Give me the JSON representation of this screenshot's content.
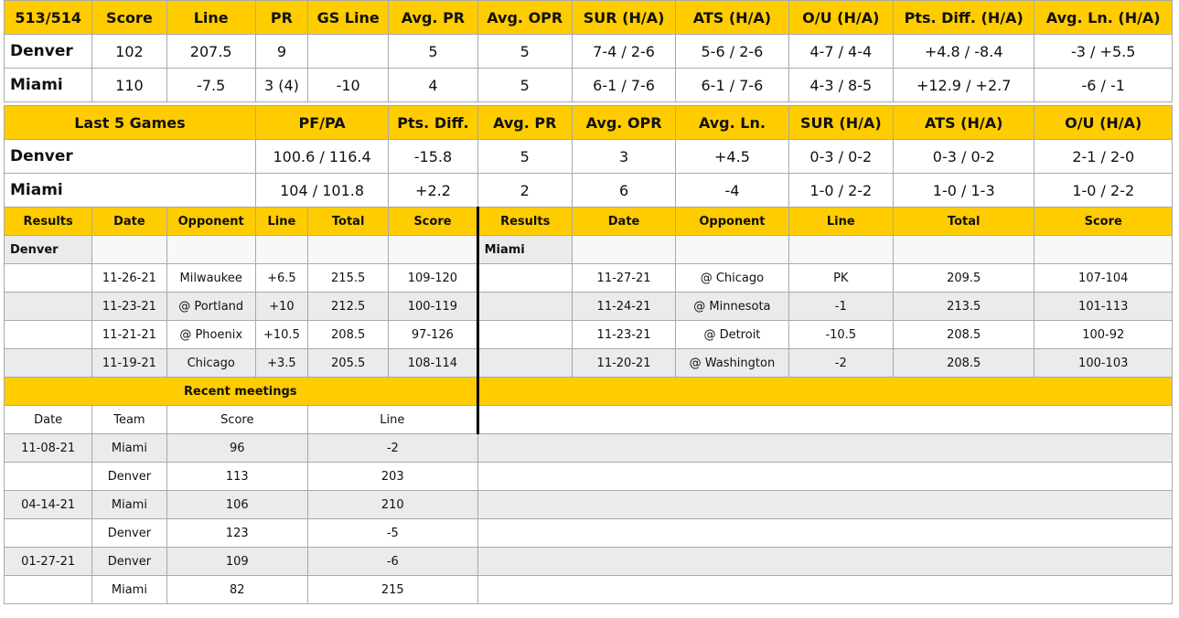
{
  "summary": {
    "headers": [
      "513/514",
      "Score",
      "Line",
      "PR",
      "GS Line",
      "Avg. PR",
      "Avg. OPR",
      "SUR (H/A)",
      "ATS (H/A)",
      "O/U (H/A)",
      "Pts. Diff. (H/A)",
      "Avg. Ln. (H/A)"
    ],
    "rows": [
      {
        "team": "Denver",
        "score": "102",
        "line": "207.5",
        "pr": "9",
        "gs_line": "",
        "avg_pr": "5",
        "avg_opr": "5",
        "sur": "7-4 / 2-6",
        "ats": "5-6 / 2-6",
        "ou": "4-7 / 4-4",
        "pts_diff": "+4.8 / -8.4",
        "avg_ln": "-3 / +5.5"
      },
      {
        "team": "Miami",
        "score": "110",
        "line": "-7.5",
        "pr": "3 (4)",
        "gs_line": "-10",
        "avg_pr": "4",
        "avg_opr": "5",
        "sur": "6-1 / 7-6",
        "ats": "6-1 / 7-6",
        "ou": "4-3 / 8-5",
        "pts_diff": "+12.9 / +2.7",
        "avg_ln": "-6 / -1"
      }
    ]
  },
  "last5": {
    "headers": [
      "Last 5 Games",
      "PF/PA",
      "Pts. Diff.",
      "Avg. PR",
      "Avg. OPR",
      "Avg. Ln.",
      "SUR (H/A)",
      "ATS (H/A)",
      "O/U (H/A)"
    ],
    "rows": [
      {
        "team": "Denver",
        "pfpa": "100.6 / 116.4",
        "pts_diff": "-15.8",
        "avg_pr": "5",
        "avg_opr": "3",
        "avg_ln": "+4.5",
        "sur": "0-3 / 0-2",
        "ats": "0-3 / 0-2",
        "ou": "2-1 / 2-0"
      },
      {
        "team": "Miami",
        "pfpa": "104 / 101.8",
        "pts_diff": "+2.2",
        "avg_pr": "2",
        "avg_opr": "6",
        "avg_ln": "-4",
        "sur": "1-0 / 2-2",
        "ats": "1-0 / 1-3",
        "ou": "1-0 / 2-2"
      }
    ]
  },
  "results": {
    "headers": [
      "Results",
      "Date",
      "Opponent",
      "Line",
      "Total",
      "Score"
    ],
    "left_team": "Denver",
    "right_team": "Miami",
    "left_rows": [
      {
        "date": "11-26-21",
        "opponent": "Milwaukee",
        "line": "+6.5",
        "total": "215.5",
        "score": "109-120"
      },
      {
        "date": "11-23-21",
        "opponent": "@ Portland",
        "line": "+10",
        "total": "212.5",
        "score": "100-119"
      },
      {
        "date": "11-21-21",
        "opponent": "@ Phoenix",
        "line": "+10.5",
        "total": "208.5",
        "score": "97-126"
      },
      {
        "date": "11-19-21",
        "opponent": "Chicago",
        "line": "+3.5",
        "total": "205.5",
        "score": "108-114"
      }
    ],
    "right_rows": [
      {
        "date": "11-27-21",
        "opponent": "@ Chicago",
        "line": "PK",
        "total": "209.5",
        "score": "107-104"
      },
      {
        "date": "11-24-21",
        "opponent": "@ Minnesota",
        "line": "-1",
        "total": "213.5",
        "score": "101-113"
      },
      {
        "date": "11-23-21",
        "opponent": "@ Detroit",
        "line": "-10.5",
        "total": "208.5",
        "score": "100-92"
      },
      {
        "date": "11-20-21",
        "opponent": "@ Washington",
        "line": "-2",
        "total": "208.5",
        "score": "100-103"
      }
    ]
  },
  "meetings": {
    "title": "Recent meetings",
    "headers": [
      "Date",
      "Team",
      "Score",
      "Line"
    ],
    "rows": [
      {
        "date": "11-08-21",
        "team": "Miami",
        "score": "96",
        "line": "-2"
      },
      {
        "date": "",
        "team": "Denver",
        "score": "113",
        "line": "203"
      },
      {
        "date": "04-14-21",
        "team": "Miami",
        "score": "106",
        "line": "210"
      },
      {
        "date": "",
        "team": "Denver",
        "score": "123",
        "line": "-5"
      },
      {
        "date": "01-27-21",
        "team": "Denver",
        "score": "109",
        "line": "-6"
      },
      {
        "date": "",
        "team": "Miami",
        "score": "82",
        "line": "215"
      }
    ]
  },
  "colors": {
    "accent": "#ffcc00",
    "alt_row": "#ebebeb",
    "border": "#a9a9a9"
  }
}
